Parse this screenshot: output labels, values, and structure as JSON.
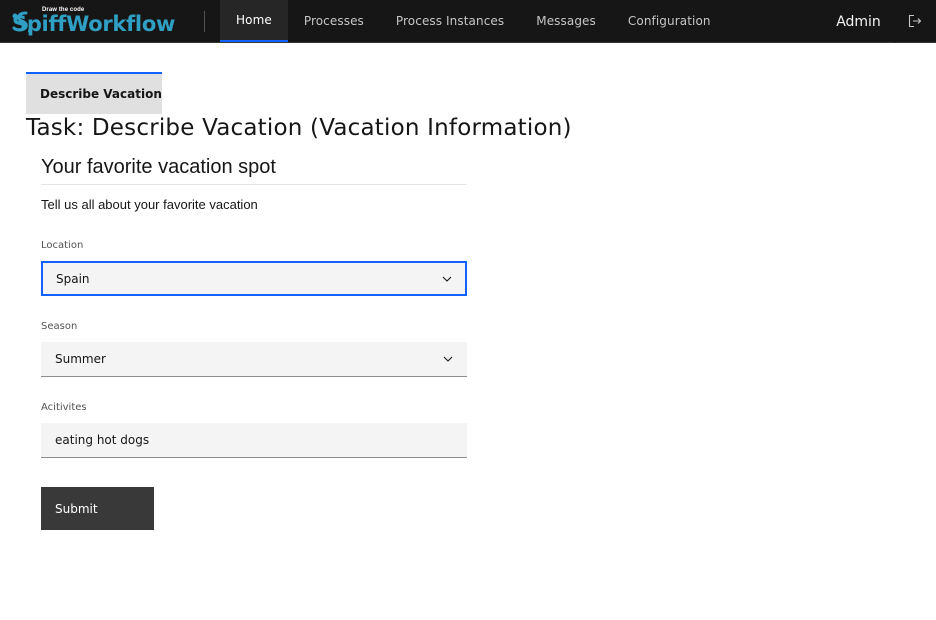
{
  "header": {
    "logo": {
      "tagline": "Draw the code",
      "name": "SpiffWorkflow"
    },
    "nav": [
      {
        "label": "Home",
        "active": true
      },
      {
        "label": "Processes",
        "active": false
      },
      {
        "label": "Process Instances",
        "active": false
      },
      {
        "label": "Messages",
        "active": false
      },
      {
        "label": "Configuration",
        "active": false
      }
    ],
    "user": "Admin",
    "logout_icon": "logout-icon"
  },
  "tab": {
    "label": "Describe Vacation"
  },
  "task_title": "Task: Describe Vacation (Vacation Information)",
  "form": {
    "title": "Your favorite vacation spot",
    "description": "Tell us all about your favorite vacation",
    "location": {
      "label": "Location",
      "value": "Spain"
    },
    "season": {
      "label": "Season",
      "value": "Summer"
    },
    "activities": {
      "label": "Acitivites",
      "value": "eating hot dogs"
    },
    "submit_label": "Submit"
  },
  "colors": {
    "header_bg": "#161616",
    "accent": "#0f62fe",
    "logo": "#2f9fc4",
    "field_bg": "#f4f4f4",
    "button_bg": "#393939"
  }
}
